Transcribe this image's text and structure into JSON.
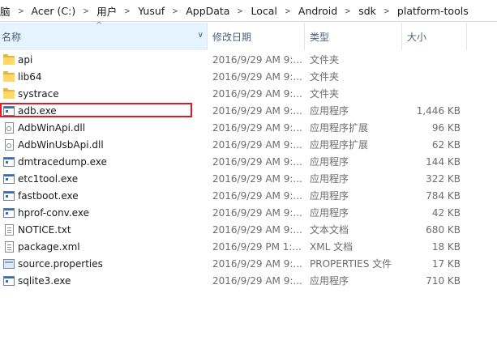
{
  "breadcrumb": [
    "脑",
    "Acer (C:)",
    "用户",
    "Yusuf",
    "AppData",
    "Local",
    "Android",
    "sdk",
    "platform-tools"
  ],
  "columns": {
    "name": "名称",
    "date": "修改日期",
    "type": "类型",
    "size": "大小"
  },
  "files": [
    {
      "name": "api",
      "date": "2016/9/29 AM 9:...",
      "type": "文件夹",
      "size": "",
      "icon": "folder-icon"
    },
    {
      "name": "lib64",
      "date": "2016/9/29 AM 9:...",
      "type": "文件夹",
      "size": "",
      "icon": "folder-icon"
    },
    {
      "name": "systrace",
      "date": "2016/9/29 AM 9:...",
      "type": "文件夹",
      "size": "",
      "icon": "folder-icon"
    },
    {
      "name": "adb.exe",
      "date": "2016/9/29 AM 9:...",
      "type": "应用程序",
      "size": "1,446 KB",
      "icon": "exe-icon"
    },
    {
      "name": "AdbWinApi.dll",
      "date": "2016/9/29 AM 9:...",
      "type": "应用程序扩展",
      "size": "96 KB",
      "icon": "dll-icon"
    },
    {
      "name": "AdbWinUsbApi.dll",
      "date": "2016/9/29 AM 9:...",
      "type": "应用程序扩展",
      "size": "62 KB",
      "icon": "dll-icon"
    },
    {
      "name": "dmtracedump.exe",
      "date": "2016/9/29 AM 9:...",
      "type": "应用程序",
      "size": "144 KB",
      "icon": "exe-icon"
    },
    {
      "name": "etc1tool.exe",
      "date": "2016/9/29 AM 9:...",
      "type": "应用程序",
      "size": "322 KB",
      "icon": "exe-icon"
    },
    {
      "name": "fastboot.exe",
      "date": "2016/9/29 AM 9:...",
      "type": "应用程序",
      "size": "784 KB",
      "icon": "exe-icon"
    },
    {
      "name": "hprof-conv.exe",
      "date": "2016/9/29 AM 9:...",
      "type": "应用程序",
      "size": "42 KB",
      "icon": "exe-icon"
    },
    {
      "name": "NOTICE.txt",
      "date": "2016/9/29 AM 9:...",
      "type": "文本文档",
      "size": "680 KB",
      "icon": "text-document-icon"
    },
    {
      "name": "package.xml",
      "date": "2016/9/29 PM 1:...",
      "type": "XML 文档",
      "size": "18 KB",
      "icon": "xml-document-icon"
    },
    {
      "name": "source.properties",
      "date": "2016/9/29 AM 9:...",
      "type": "PROPERTIES 文件",
      "size": "17 KB",
      "icon": "properties-file-icon"
    },
    {
      "name": "sqlite3.exe",
      "date": "2016/9/29 AM 9:...",
      "type": "应用程序",
      "size": "710 KB",
      "icon": "exe-icon"
    }
  ],
  "highlighted_file": "adb.exe",
  "colors": {
    "highlight_border": "#e01b24",
    "header_text": "#4c607a",
    "header_active_bg": "#e5f3ff",
    "folder": "#ffd866"
  }
}
